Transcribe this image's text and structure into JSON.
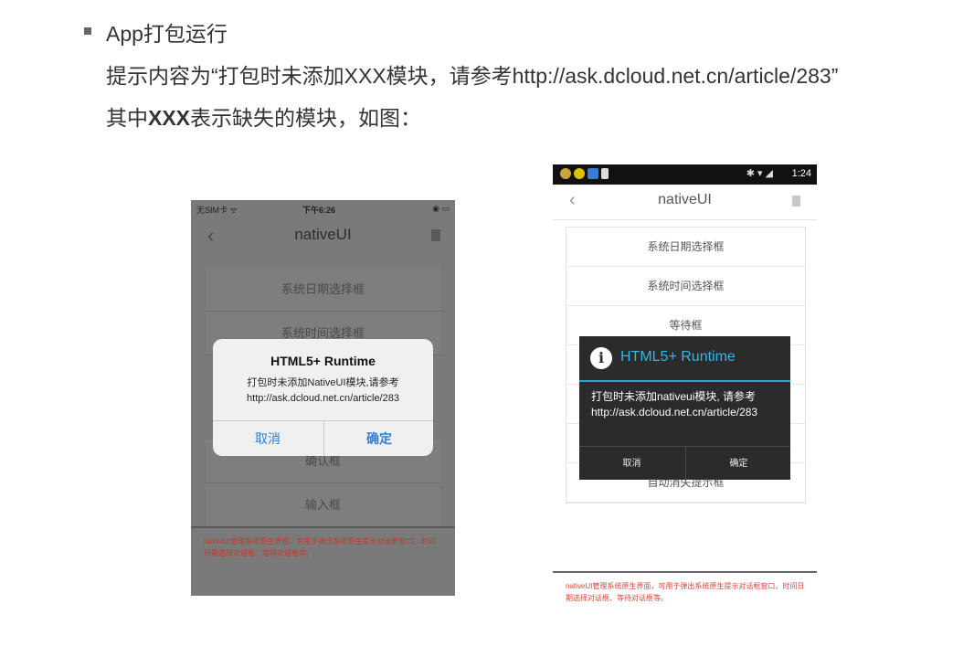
{
  "doc": {
    "bullet_title": "App打包运行",
    "line2": "提示内容为“打包时未添加XXX模块，请参考http://ask.dcloud.net.cn/article/283”",
    "line3_prefix": "其中",
    "line3_bold": "XXX",
    "line3_suffix": "表示缺失的模块，如图："
  },
  "ios": {
    "status_left": "无SIM卡 ᯤ",
    "status_time": "下午6:26",
    "status_right": "◉ ▭",
    "back_icon": "chevron-left",
    "title": "nativeUI",
    "items_top": [
      "系统日期选择框",
      "系统时间选择框"
    ],
    "items_bottom": [
      "确认框",
      "输入框"
    ],
    "footer": "nativeUI管理系统原生界面，可用于弹出系统原生提示对话框窗口、时间日期选择对话框、等待对话框等。",
    "dialog": {
      "title": "HTML5+ Runtime",
      "message": "打包时未添加NativeUI模块,请参考http://ask.dcloud.net.cn/article/283",
      "cancel": "取消",
      "ok": "确定"
    }
  },
  "android": {
    "time": "1:24",
    "status_right": "✱ ▾ ◢",
    "back_icon": "chevron-left",
    "title": "nativeUI",
    "items": [
      "系统日期选择框",
      "系统时间选择框",
      "等待框",
      "",
      "",
      "",
      "自动消失提示框"
    ],
    "footer": "nativeUI管理系统原生界面，可用于弹出系统原生提示对话框窗口、时间日期选择对话框、等待对话框等。",
    "dialog": {
      "title": "HTML5+ Runtime",
      "message": "打包时未添加nativeui模块, 请参考 http://ask.dcloud.net.cn/article/283",
      "cancel": "取消",
      "ok": "确定"
    },
    "status_icon_colors": [
      "#c9a43a",
      "#e0c000",
      "#3a7bd5",
      "#dddddd"
    ]
  }
}
